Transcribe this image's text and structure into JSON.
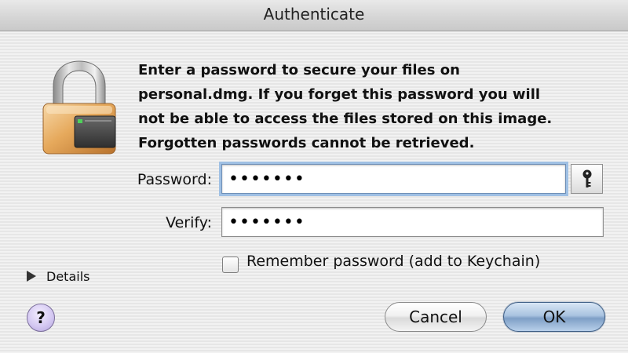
{
  "window": {
    "title": "Authenticate"
  },
  "message": "Enter a password to secure your files on\npersonal.dmg.  If you forget this password you will\nnot be able to access the files stored on this image.\nForgotten passwords cannot be retrieved.",
  "form": {
    "password_label": "Password:",
    "password_value": "•••••••",
    "verify_label": "Verify:",
    "verify_value": "•••••••",
    "remember_label": "Remember password (add to Keychain)",
    "remember_checked": false
  },
  "details": {
    "label": "Details",
    "expanded": false
  },
  "buttons": {
    "help_label": "?",
    "cancel_label": "Cancel",
    "ok_label": "OK"
  },
  "icons": {
    "lock": "lock-icon",
    "key": "key-icon",
    "disclosure": "disclosure-triangle-icon"
  },
  "colors": {
    "default_button": "#a9c3e0",
    "focus_ring": "#9fc0e4",
    "help_button": "#d5c9f2"
  }
}
